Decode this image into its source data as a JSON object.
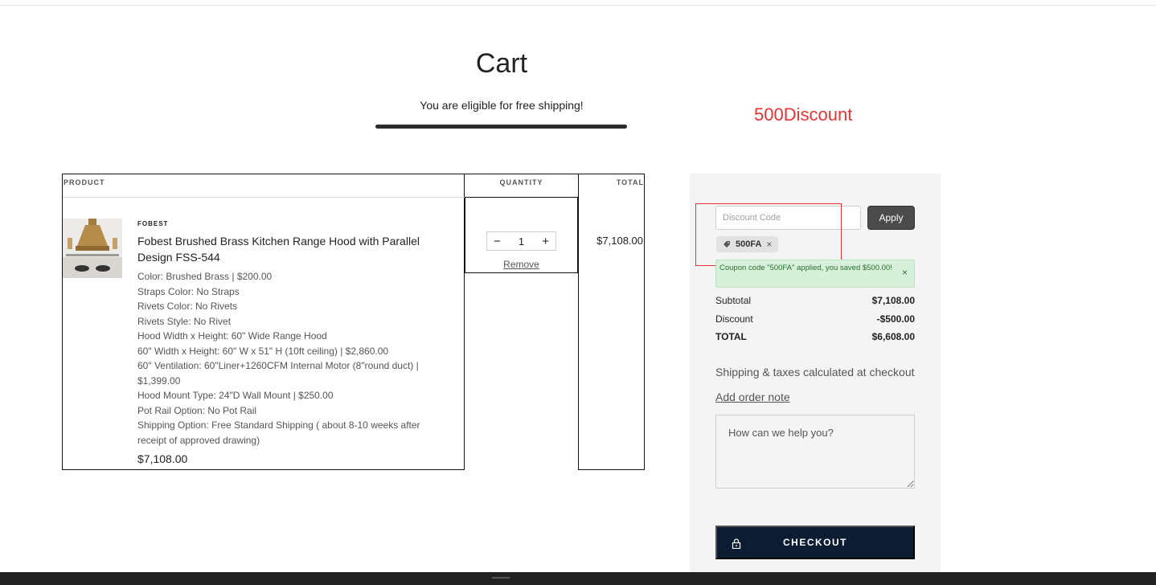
{
  "page": {
    "title": "Cart",
    "free_shipping": "You are eligible for free shipping!",
    "annotation": "500Discount"
  },
  "table": {
    "headers": {
      "product": "PRODUCT",
      "quantity": "QUANTITY",
      "total": "TOTAL"
    }
  },
  "item": {
    "brand": "FOBEST",
    "title": "Fobest Brushed Brass Kitchen Range Hood with Parallel Design FSS-544",
    "options": [
      "Color: Brushed Brass | $200.00",
      "Straps Color: No Straps",
      "Rivets Color: No Rivets",
      "Rivets Style: No Rivet",
      "Hood Width x Height: 60\" Wide Range Hood",
      "60\" Width x Height: 60\" W x 51\" H (10ft ceiling) | $2,860.00",
      "60\" Ventilation: 60\"Liner+1260CFM Internal Motor (8\"round duct) | $1,399.00",
      "Hood Mount Type: 24\"D Wall Mount | $250.00",
      "Pot Rail Option: No Pot Rail",
      "Shipping Option: Free Standard Shipping ( about 8-10 weeks after receipt of approved drawing)"
    ],
    "price": "$7,108.00",
    "quantity": "1",
    "minus": "−",
    "plus": "+",
    "remove": "Remove",
    "line_total": "$7,108.00"
  },
  "summary": {
    "discount_placeholder": "Discount Code",
    "apply": "Apply",
    "applied_code": "500FA",
    "chip_remove": "×",
    "alert": "Coupon code \"500FA\" applied, you saved $500.00!",
    "alert_close": "×",
    "subtotal_label": "Subtotal",
    "subtotal_value": "$7,108.00",
    "discount_label": "Discount",
    "discount_value": "-$500.00",
    "total_label": "TOTAL",
    "total_value": "$6,608.00",
    "shipping_note": "Shipping & taxes calculated at checkout",
    "order_note_link": "Add order note",
    "order_note_placeholder": "How can we help you?",
    "checkout": "CHECKOUT"
  },
  "colors": {
    "checkout_bg": "#0c1d33",
    "annotation_red": "#e63434",
    "alert_bg": "#d7f0d9"
  }
}
